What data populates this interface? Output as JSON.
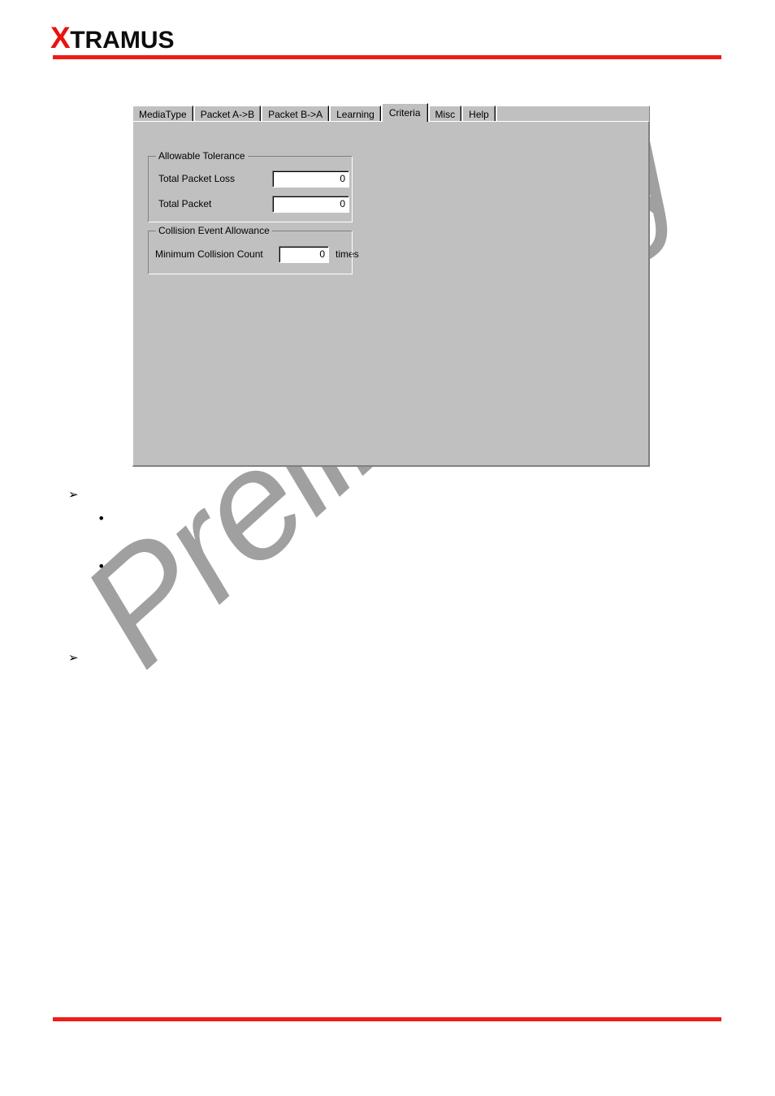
{
  "document": {
    "brand": {
      "logo_first_letter": "X",
      "logo_rest": "TRAMUS"
    },
    "watermark": {
      "text": "Preliminary",
      "color": "#a0a0a0"
    },
    "accent_color": "#ed1c16",
    "rules": {
      "header_rule": "",
      "footer_rule": ""
    },
    "body_list": [
      {
        "marker": "➢",
        "text": ""
      },
      {
        "marker": "•",
        "text": ""
      },
      {
        "marker": "•",
        "text": ""
      },
      {
        "marker": "➢",
        "text": ""
      }
    ]
  },
  "dialog": {
    "background_color": "#c0c0c0",
    "tabs": [
      {
        "label": "MediaType",
        "selected": false
      },
      {
        "label": "Packet A->B",
        "selected": false
      },
      {
        "label": "Packet B->A",
        "selected": false
      },
      {
        "label": "Learning",
        "selected": false
      },
      {
        "label": "Criteria",
        "selected": true
      },
      {
        "label": "Misc",
        "selected": false
      },
      {
        "label": "Help",
        "selected": false
      }
    ],
    "groups": {
      "allowable_tolerance": {
        "title": "Allowable Tolerance",
        "fields": [
          {
            "label": "Total Packet Loss",
            "value": "0",
            "placeholder": "0"
          },
          {
            "label": "Total Packet",
            "value": "0",
            "placeholder": "0"
          }
        ]
      },
      "collision_event_allowance": {
        "title": "Collision Event Allowance",
        "fields": [
          {
            "label": "Minimum Collision Count",
            "value": "0",
            "placeholder": "0",
            "suffix": "times"
          }
        ]
      }
    }
  }
}
